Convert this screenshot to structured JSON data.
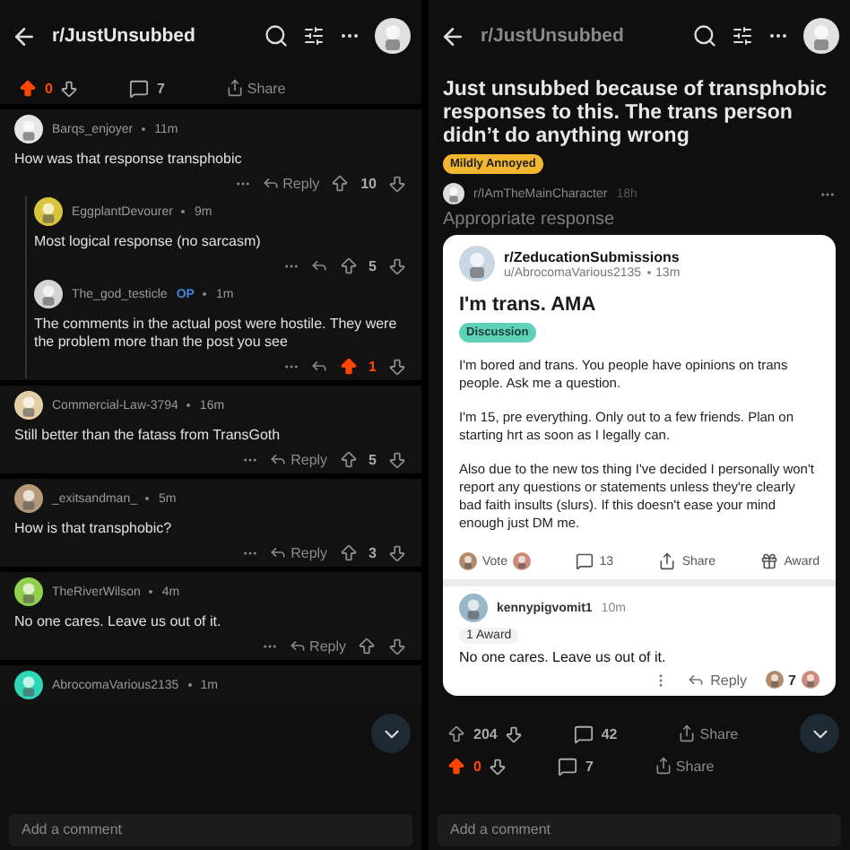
{
  "left": {
    "header": {
      "title": "r/JustUnsubbed",
      "dimmed": false
    },
    "vote_bar": {
      "upvoted": true,
      "score": "0",
      "comments": "7",
      "share": "Share"
    },
    "comments": [
      {
        "author": "Barqs_enjoyer",
        "time": "11m",
        "color": "#e6e6e6",
        "body": "How was that response transphobic",
        "reply": "Reply",
        "score": "10",
        "upvoted": false,
        "children": [
          {
            "author": "EggplantDevourer",
            "time": "9m",
            "color": "#d9c53b",
            "body": "Most logical response (no sarcasm)",
            "score": "5",
            "upvoted": false
          },
          {
            "author": "The_god_testicle",
            "op": "OP",
            "time": "1m",
            "color": "#d4d4d4",
            "body": "The comments in the actual post were hostile. They were the problem more than the post you see",
            "score": "1",
            "upvoted": true
          }
        ]
      },
      {
        "author": "Commercial-Law-3794",
        "time": "16m",
        "color": "#e3cfa6",
        "body": "Still better than the fatass from TransGoth",
        "reply": "Reply",
        "score": "5",
        "upvoted": false
      },
      {
        "author": "_exitsandman_",
        "time": "5m",
        "color": "#b59a7a",
        "body": "How is that transphobic?",
        "reply": "Reply",
        "score": "3",
        "upvoted": false
      },
      {
        "author": "TheRiverWilson",
        "time": "4m",
        "color": "#8fd14f",
        "body": "No one cares. Leave us out of it.",
        "reply": "Reply",
        "upvoted": false
      },
      {
        "author": "AbrocomaVarious2135",
        "time": "1m",
        "color": "#2ed6b6"
      }
    ],
    "add_comment": {
      "placeholder": "Add a comment"
    }
  },
  "right": {
    "header": {
      "title": "r/JustUnsubbed",
      "dimmed": true
    },
    "post": {
      "title": "Just unsubbed because of transphobic responses to this. The trans person didn’t do anything wrong",
      "flair": "Mildly Annoyed",
      "crosspost": {
        "subreddit": "r/IAmTheMainCharacter",
        "time": "18h"
      },
      "body": "Appropriate response",
      "embed": {
        "subreddit": "r/ZeducationSubmissions",
        "user": "u/AbrocomaVarious2135",
        "time": "13m",
        "title": "I'm trans. AMA",
        "flair": "Discussion",
        "paragraphs": [
          "I'm bored and trans. You people have opinions on trans people. Ask me a question.",
          "I'm 15, pre everything. Only out to a few friends. Plan on starting hrt as soon as I legally can.",
          "Also due to the new tos thing I've decided I personally won't report any questions or statements unless they're clearly bad faith insults (slurs). If this doesn't ease your mind enough just DM me."
        ],
        "actions": {
          "vote": "Vote",
          "comments": "13",
          "share": "Share",
          "award": "Award"
        },
        "comment": {
          "author": "kennypigvomit1",
          "time": "10m",
          "award": "1 Award",
          "body": "No one cares. Leave us out of it.",
          "reply": "Reply",
          "score": "7"
        }
      }
    },
    "stat_rows": [
      {
        "upvoted": false,
        "score": "204",
        "comments": "42",
        "share": "Share"
      },
      {
        "upvoted": true,
        "score": "0",
        "comments": "7",
        "share": "Share"
      }
    ],
    "add_comment": {
      "placeholder": "Add a comment"
    }
  }
}
